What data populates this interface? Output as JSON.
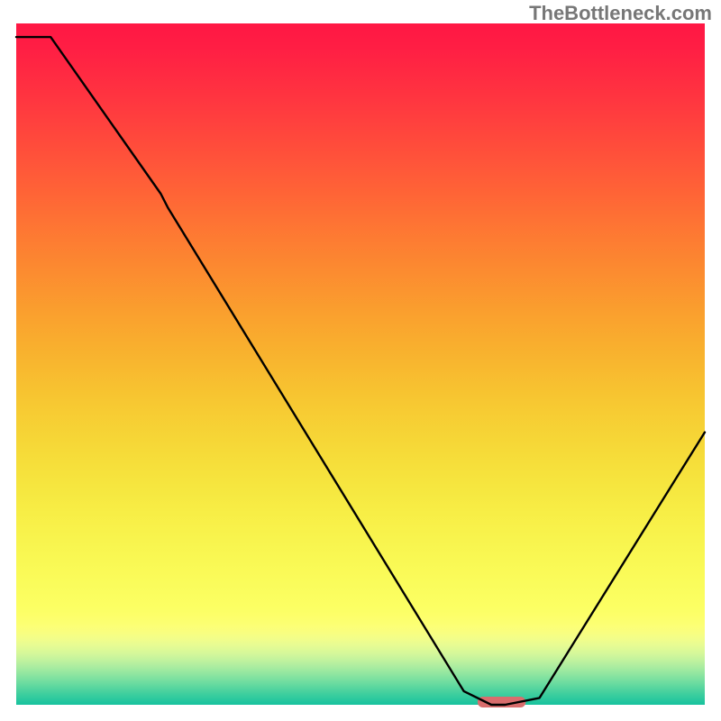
{
  "watermark": "TheBottleneck.com",
  "chart_data": {
    "type": "line",
    "title": "",
    "xlabel": "",
    "ylabel": "",
    "xlim": [
      0,
      100
    ],
    "ylim": [
      0,
      100
    ],
    "x": [
      0,
      5,
      21,
      22,
      65,
      69,
      71,
      76,
      100
    ],
    "values": [
      98,
      98,
      75,
      73,
      2,
      0,
      0,
      1,
      40
    ],
    "marker": {
      "x_start": 67,
      "x_end": 74,
      "y": 0,
      "color": "#d96d6d"
    },
    "gradient_stops": [
      {
        "offset": 0.0,
        "color": "#ff1744"
      },
      {
        "offset": 0.035,
        "color": "#ff1e44"
      },
      {
        "offset": 0.071,
        "color": "#ff2942"
      },
      {
        "offset": 0.107,
        "color": "#ff3440"
      },
      {
        "offset": 0.143,
        "color": "#ff403e"
      },
      {
        "offset": 0.179,
        "color": "#ff4c3b"
      },
      {
        "offset": 0.214,
        "color": "#ff5839"
      },
      {
        "offset": 0.25,
        "color": "#ff6436"
      },
      {
        "offset": 0.286,
        "color": "#fe7134"
      },
      {
        "offset": 0.321,
        "color": "#fd7d32"
      },
      {
        "offset": 0.357,
        "color": "#fc8930"
      },
      {
        "offset": 0.393,
        "color": "#fb952f"
      },
      {
        "offset": 0.429,
        "color": "#faa12e"
      },
      {
        "offset": 0.464,
        "color": "#f9ac2e"
      },
      {
        "offset": 0.5,
        "color": "#f8b72f"
      },
      {
        "offset": 0.536,
        "color": "#f7c230"
      },
      {
        "offset": 0.571,
        "color": "#f7cc33"
      },
      {
        "offset": 0.607,
        "color": "#f6d536"
      },
      {
        "offset": 0.643,
        "color": "#f6de3a"
      },
      {
        "offset": 0.679,
        "color": "#f6e63f"
      },
      {
        "offset": 0.714,
        "color": "#f7ed45"
      },
      {
        "offset": 0.75,
        "color": "#f8f34c"
      },
      {
        "offset": 0.786,
        "color": "#f9f853"
      },
      {
        "offset": 0.821,
        "color": "#fafc5b"
      },
      {
        "offset": 0.857,
        "color": "#fcff63"
      },
      {
        "offset": 0.87,
        "color": "#fdff6a"
      },
      {
        "offset": 0.885,
        "color": "#fcff76"
      },
      {
        "offset": 0.895,
        "color": "#f8fe81"
      },
      {
        "offset": 0.905,
        "color": "#f0fd8c"
      },
      {
        "offset": 0.915,
        "color": "#e4fb94"
      },
      {
        "offset": 0.925,
        "color": "#d4f79a"
      },
      {
        "offset": 0.935,
        "color": "#c0f29e"
      },
      {
        "offset": 0.945,
        "color": "#a9eca0"
      },
      {
        "offset": 0.955,
        "color": "#8fe6a0"
      },
      {
        "offset": 0.965,
        "color": "#74dea0"
      },
      {
        "offset": 0.975,
        "color": "#58d69f"
      },
      {
        "offset": 0.985,
        "color": "#3cce9e"
      },
      {
        "offset": 1.0,
        "color": "#17c29e"
      }
    ]
  }
}
